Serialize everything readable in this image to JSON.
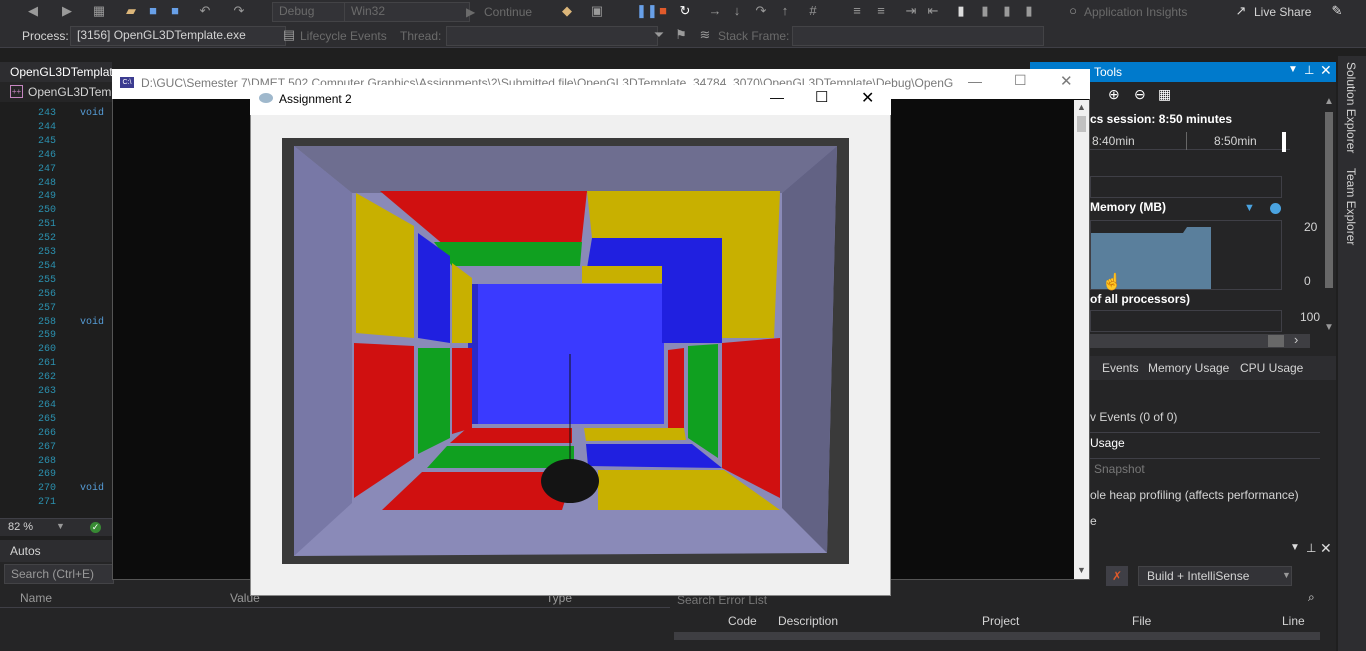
{
  "toolbar": {
    "config": "Debug",
    "platform": "Win32",
    "continue_label": "Continue",
    "app_insights": "Application Insights",
    "live_share": "Live Share"
  },
  "process_bar": {
    "process_label": "Process:",
    "process_value": "[3156] OpenGL3DTemplate.exe",
    "lifecycle": "Lifecycle Events",
    "thread_label": "Thread:",
    "stack_frame_label": "Stack Frame:"
  },
  "editor": {
    "tab_label": "OpenGL3DTemplate",
    "tab2_label": "OpenGL3DTemp",
    "lines": [
      "243",
      "244",
      "245",
      "246",
      "247",
      "248",
      "249",
      "250",
      "251",
      "252",
      "253",
      "254",
      "255",
      "256",
      "257",
      "258",
      "259",
      "260",
      "261",
      "262",
      "263",
      "264",
      "265",
      "266",
      "267",
      "268",
      "269",
      "270",
      "271"
    ],
    "zoom": "82 %",
    "kw_void": "void"
  },
  "console_window": {
    "title": "D:\\GUC\\Semester 7\\DMET 502 Computer Graphics\\Assignments\\2\\Submitted file\\OpenGL3DTemplate_34784_3070\\OpenGL3DTemplate\\Debug\\OpenG..."
  },
  "app_window": {
    "title": "Assignment 2"
  },
  "diagnostics": {
    "title": "Tools",
    "session": "cs session: 8:50 minutes",
    "tick1": "8:40min",
    "tick2": "8:50min",
    "memory_label": "Memory (MB)",
    "mem_max": "20",
    "mem_min": "0",
    "cpu_label": "of all processors)",
    "cpu_max": "100",
    "tabs": [
      "Events",
      "Memory Usage",
      "CPU Usage"
    ],
    "items": [
      "v Events (0 of 0)",
      "Usage",
      "Snapshot",
      "ole heap profiling (affects performance)",
      "e"
    ]
  },
  "side_tabs": {
    "solution_explorer": "Solution Explorer",
    "team_explorer": "Team Explorer"
  },
  "autos": {
    "title": "Autos",
    "search": "Search (Ctrl+E)",
    "col_name": "Name",
    "col_value": "Value",
    "col_type": "Type"
  },
  "error_list": {
    "search": "Search Error List",
    "build_filter": "Build + IntelliSense",
    "col_code": "Code",
    "col_description": "Description",
    "col_project": "Project",
    "col_file": "File",
    "col_line": "Line"
  }
}
